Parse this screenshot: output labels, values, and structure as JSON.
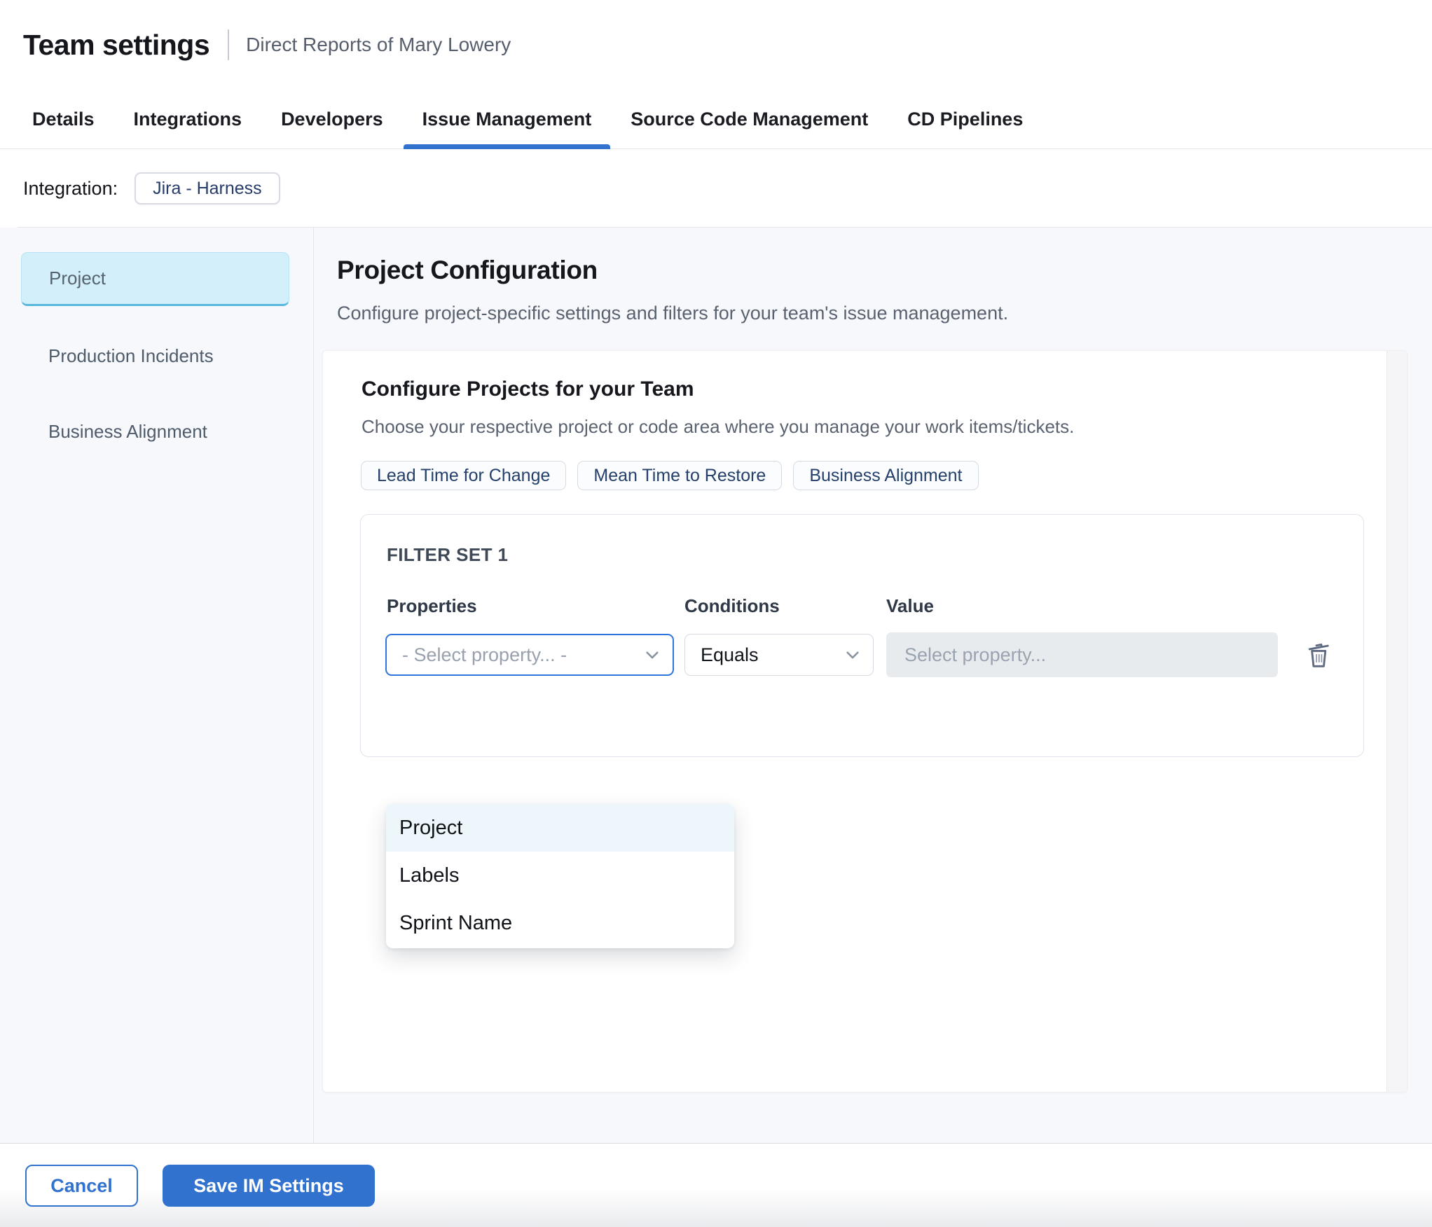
{
  "header": {
    "title": "Team settings",
    "subtitle": "Direct Reports of Mary Lowery"
  },
  "tabs": [
    {
      "label": "Details",
      "active": false
    },
    {
      "label": "Integrations",
      "active": false
    },
    {
      "label": "Developers",
      "active": false
    },
    {
      "label": "Issue Management",
      "active": true
    },
    {
      "label": "Source Code Management",
      "active": false
    },
    {
      "label": "CD Pipelines",
      "active": false
    }
  ],
  "integration": {
    "label": "Integration:",
    "chip": "Jira - Harness"
  },
  "sidebar": {
    "items": [
      {
        "label": "Project",
        "active": true
      },
      {
        "label": "Production Incidents",
        "active": false
      },
      {
        "label": "Business Alignment",
        "active": false
      }
    ]
  },
  "main": {
    "title": "Project Configuration",
    "subtitle": "Configure project-specific settings and filters for your team's issue management.",
    "card": {
      "title": "Configure Projects for your Team",
      "subtitle": "Choose your respective project or code area where you manage your work items/tickets.",
      "metric_chips": [
        {
          "label": "Lead Time for Change"
        },
        {
          "label": "Mean Time to Restore"
        },
        {
          "label": "Business Alignment"
        }
      ],
      "filter_set": {
        "title": "FILTER SET 1",
        "columns": {
          "properties": "Properties",
          "conditions": "Conditions",
          "value": "Value"
        },
        "properties_placeholder": "- Select property... -",
        "conditions_value": "Equals",
        "value_placeholder": "Select property...",
        "dropdown_options": [
          {
            "label": "Project",
            "highlighted": true
          },
          {
            "label": "Labels",
            "highlighted": false
          },
          {
            "label": "Sprint Name",
            "highlighted": false
          }
        ]
      }
    }
  },
  "footer": {
    "cancel_label": "Cancel",
    "save_label": "Save IM Settings"
  },
  "icons": {
    "select_caret": "chevron-down",
    "remove_filter": "trash"
  },
  "colors": {
    "accent_blue": "#3272cf",
    "focus_blue": "#2f74dd",
    "sidebar_active_bg": "#d2effa",
    "sidebar_active_border": "#58b7dd",
    "dropdown_highlight": "#edf6fb",
    "content_bg": "#f7f8fb",
    "disabled_input_bg": "#e8ebee"
  }
}
